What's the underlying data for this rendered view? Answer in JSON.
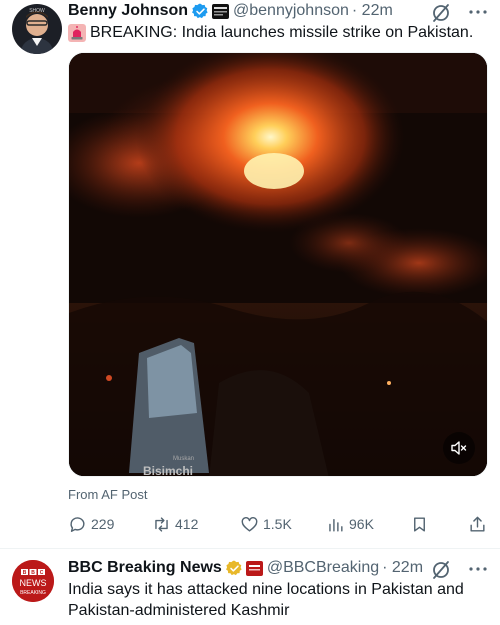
{
  "tweets": [
    {
      "author": {
        "name": "Benny Johnson",
        "handle": "@bennyjohnson",
        "time": "· 22m"
      },
      "text": "BREAKING: India launches missile strike on Pakistan.",
      "media": {
        "watermark": "Bisimchi",
        "watermark_small": "Muskan"
      },
      "source": "From AF Post",
      "actions": {
        "replies": "229",
        "reposts": "412",
        "likes": "1.5K",
        "views": "96K"
      }
    },
    {
      "author": {
        "name": "BBC Breaking News",
        "handle": "@BBCBreaking",
        "time": "· 22m",
        "avatar_lines": [
          "BBC",
          "NEWS",
          "BREAKING"
        ]
      },
      "text": "India says it has attacked nine locations in Pakistan and Pakistan-administered Kashmir"
    }
  ],
  "colors": {
    "text": "#0f1419",
    "muted": "#536471",
    "verified_blue": "#1d9bf0",
    "verified_gold": "#e8b829",
    "bbc_red": "#bb1919"
  },
  "icons": [
    "verified-icon",
    "grok-icon",
    "more-icon",
    "siren-icon",
    "mute-icon",
    "reply-icon",
    "repost-icon",
    "like-icon",
    "views-icon",
    "bookmark-icon",
    "share-icon"
  ]
}
